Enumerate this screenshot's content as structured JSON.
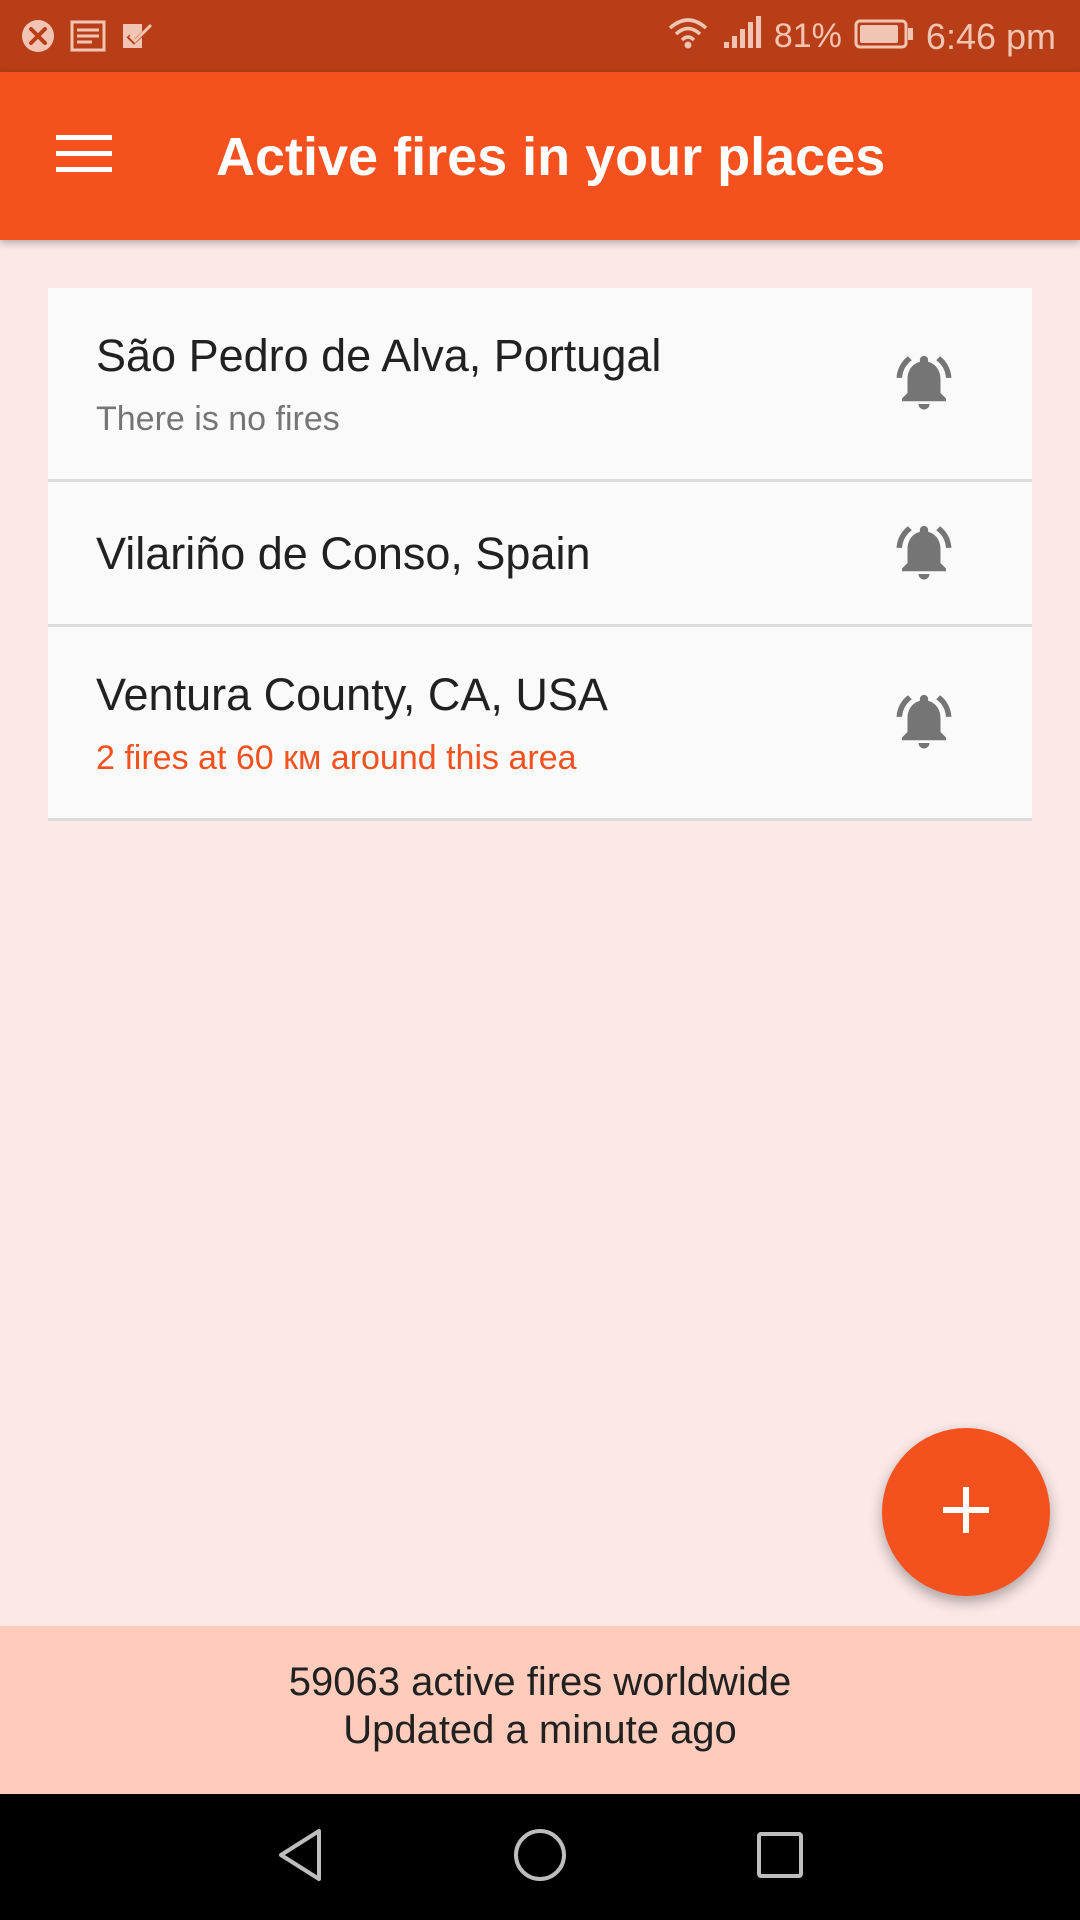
{
  "status_bar": {
    "battery_percent": "81%",
    "time": "6:46 pm"
  },
  "app_bar": {
    "title": "Active fires in your places",
    "menu_icon": "hamburger-menu-icon"
  },
  "places": [
    {
      "name": "São Pedro de Alva, Portugal",
      "status": "There is no fires",
      "status_type": "none"
    },
    {
      "name": "Vilariño de Conso, Spain",
      "status": "",
      "status_type": ""
    },
    {
      "name": "Ventura County, CA, USA",
      "status": "2 fires at 60 км around this area",
      "status_type": "alert"
    }
  ],
  "footer": {
    "fires_worldwide": "59063 active fires worldwide",
    "updated": "Updated a minute ago"
  },
  "colors": {
    "accent": "#f4511e",
    "status_bar": "#b83e17",
    "background": "#fbe9e7",
    "footer": "#ffccbc",
    "icon_gray": "#757575"
  }
}
